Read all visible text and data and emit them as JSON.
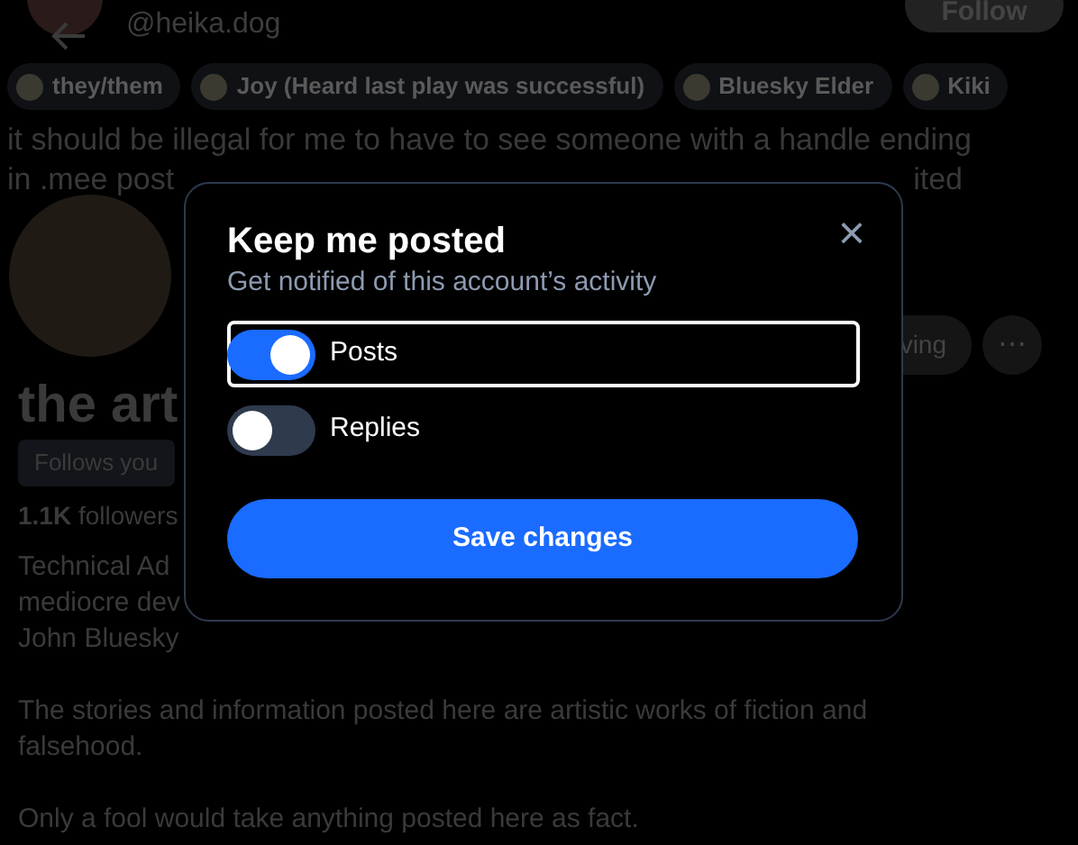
{
  "profile": {
    "handle": "@heika.dog",
    "follow_button": "Follow",
    "tags": [
      {
        "label": "they/them"
      },
      {
        "label": "Joy (Heard last play was successful)"
      },
      {
        "label": "Bluesky Elder"
      },
      {
        "label": "Kiki"
      }
    ],
    "pinned_text": {
      "line_1": "it should be illegal for me to have to see someone with a handle ending",
      "line_2_start": "in .mee post",
      "line_2_end": "ited"
    },
    "following_button": "ving",
    "more_button": "⋯",
    "name": "the art",
    "follows_you": "Follows you",
    "followers_count": "1.1K",
    "followers_label": "followers",
    "bio_lines": [
      "Technical Ad",
      "mediocre dev",
      "John Bluesky"
    ],
    "paragraphs": [
      "The stories and information posted here are artistic works of fiction and falsehood.",
      "Only a fool would take anything posted here as fact."
    ]
  },
  "dialog": {
    "title": "Keep me posted",
    "subtitle": "Get notified of this account’s activity",
    "close": "×",
    "options": [
      {
        "label": "Posts",
        "on": true,
        "focused": true
      },
      {
        "label": "Replies",
        "on": false,
        "focused": false
      }
    ],
    "save_button": "Save changes"
  }
}
